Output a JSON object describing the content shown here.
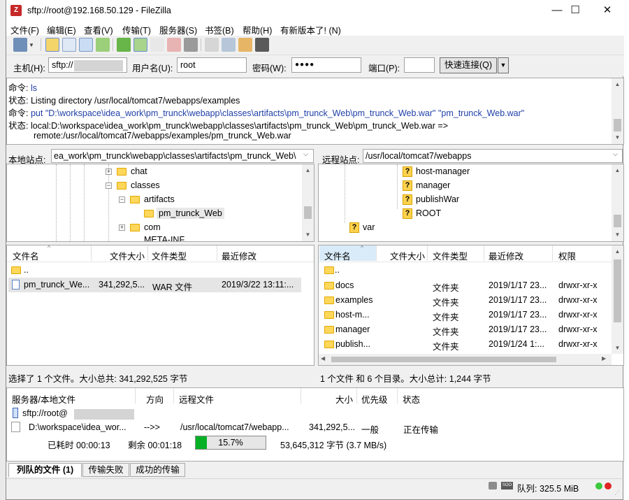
{
  "window": {
    "title": "sftp://root@192.168.50.129 - FileZilla",
    "minimize": "—",
    "maximize": "☐",
    "close": "✕"
  },
  "menu": [
    "文件(F)",
    "编辑(E)",
    "查看(V)",
    "传输(T)",
    "服务器(S)",
    "书签(B)",
    "帮助(H)",
    "有新版本了! (N)"
  ],
  "quickconnect": {
    "host_label": "主机(H):",
    "host_value": "sftp://",
    "user_label": "用户名(U):",
    "user_value": "root",
    "pass_label": "密码(W):",
    "pass_value": "●●●●",
    "port_label": "端口(P):",
    "port_value": "",
    "button": "快速连接(Q)"
  },
  "log": [
    {
      "label": "命令:",
      "text": "ls",
      "type": "command"
    },
    {
      "label": "状态:",
      "text": "Listing directory /usr/local/tomcat7/webapps/examples",
      "type": "status"
    },
    {
      "label": "命令:",
      "text": "put \"D:\\workspace\\idea_work\\pm_trunck\\webapp\\classes\\artifacts\\pm_trunck_Web\\pm_trunck_Web.war\" \"pm_trunck_Web.war\"",
      "type": "command"
    },
    {
      "label": "状态:",
      "text": "local:D:\\workspace\\idea_work\\pm_trunck\\webapp\\classes\\artifacts\\pm_trunck_Web\\pm_trunck_Web.war =>",
      "type": "status"
    },
    {
      "label": "",
      "text": "remote:/usr/local/tomcat7/webapps/examples/pm_trunck_Web.war",
      "type": "status"
    }
  ],
  "local": {
    "site_label": "本地站点:",
    "path": "ea_work\\pm_trunck\\webapp\\classes\\artifacts\\pm_trunck_Web\\",
    "tree": [
      "chat",
      "classes",
      "artifacts",
      "pm_trunck_Web",
      "com",
      "META-INF"
    ],
    "headers": [
      "文件名",
      "文件大小",
      "文件类型",
      "最近修改"
    ],
    "files": [
      {
        "name": "..",
        "size": "",
        "type": "",
        "modified": ""
      },
      {
        "name": "pm_trunck_We...",
        "size": "341,292,5...",
        "type": "WAR 文件",
        "modified": "2019/3/22 13:11:..."
      }
    ],
    "status": "选择了 1 个文件。大小总共: 341,292,525 字节"
  },
  "remote": {
    "site_label": "远程站点:",
    "path": "/usr/local/tomcat7/webapps",
    "tree": [
      "host-manager",
      "manager",
      "publishWar",
      "ROOT",
      "var"
    ],
    "headers": [
      "文件名",
      "文件大小",
      "文件类型",
      "最近修改",
      "权限"
    ],
    "files": [
      {
        "name": "..",
        "size": "",
        "type": "",
        "modified": "",
        "perm": ""
      },
      {
        "name": "docs",
        "size": "",
        "type": "文件夹",
        "modified": "2019/1/17 23...",
        "perm": "drwxr-xr-x"
      },
      {
        "name": "examples",
        "size": "",
        "type": "文件夹",
        "modified": "2019/1/17 23...",
        "perm": "drwxr-xr-x"
      },
      {
        "name": "host-m...",
        "size": "",
        "type": "文件夹",
        "modified": "2019/1/17 23...",
        "perm": "drwxr-xr-x"
      },
      {
        "name": "manager",
        "size": "",
        "type": "文件夹",
        "modified": "2019/1/17 23...",
        "perm": "drwxr-xr-x"
      },
      {
        "name": "publish...",
        "size": "",
        "type": "文件夹",
        "modified": "2019/1/24 1:...",
        "perm": "drwxr-xr-x"
      }
    ],
    "status": "1 个文件 和 6 个目录。大小总计: 1,244 字节"
  },
  "queue": {
    "headers": [
      "服务器/本地文件",
      "方向",
      "远程文件",
      "大小",
      "优先级",
      "状态"
    ],
    "server": "sftp://root@",
    "item": {
      "local": "D:\\workspace\\idea_wor...",
      "direction": "-->>",
      "remote": "/usr/local/tomcat7/webapp...",
      "size": "341,292,5...",
      "priority": "一般",
      "status": "正在传输"
    },
    "elapsed": "已耗时 00:00:13",
    "remaining": "剩余 00:01:18",
    "progress_percent": 15.7,
    "progress_text": "15.7%",
    "transferred": "53,645,312 字节 (3.7 MB/s)"
  },
  "tabs": [
    "列队的文件 (1)",
    "传输失败",
    "成功的传输"
  ],
  "statusbar": {
    "queue": "队列: 325.5 MiB"
  },
  "colors": {
    "progress": "#06b025",
    "command": "#1f3fa8",
    "selection": "#cce8ff"
  }
}
